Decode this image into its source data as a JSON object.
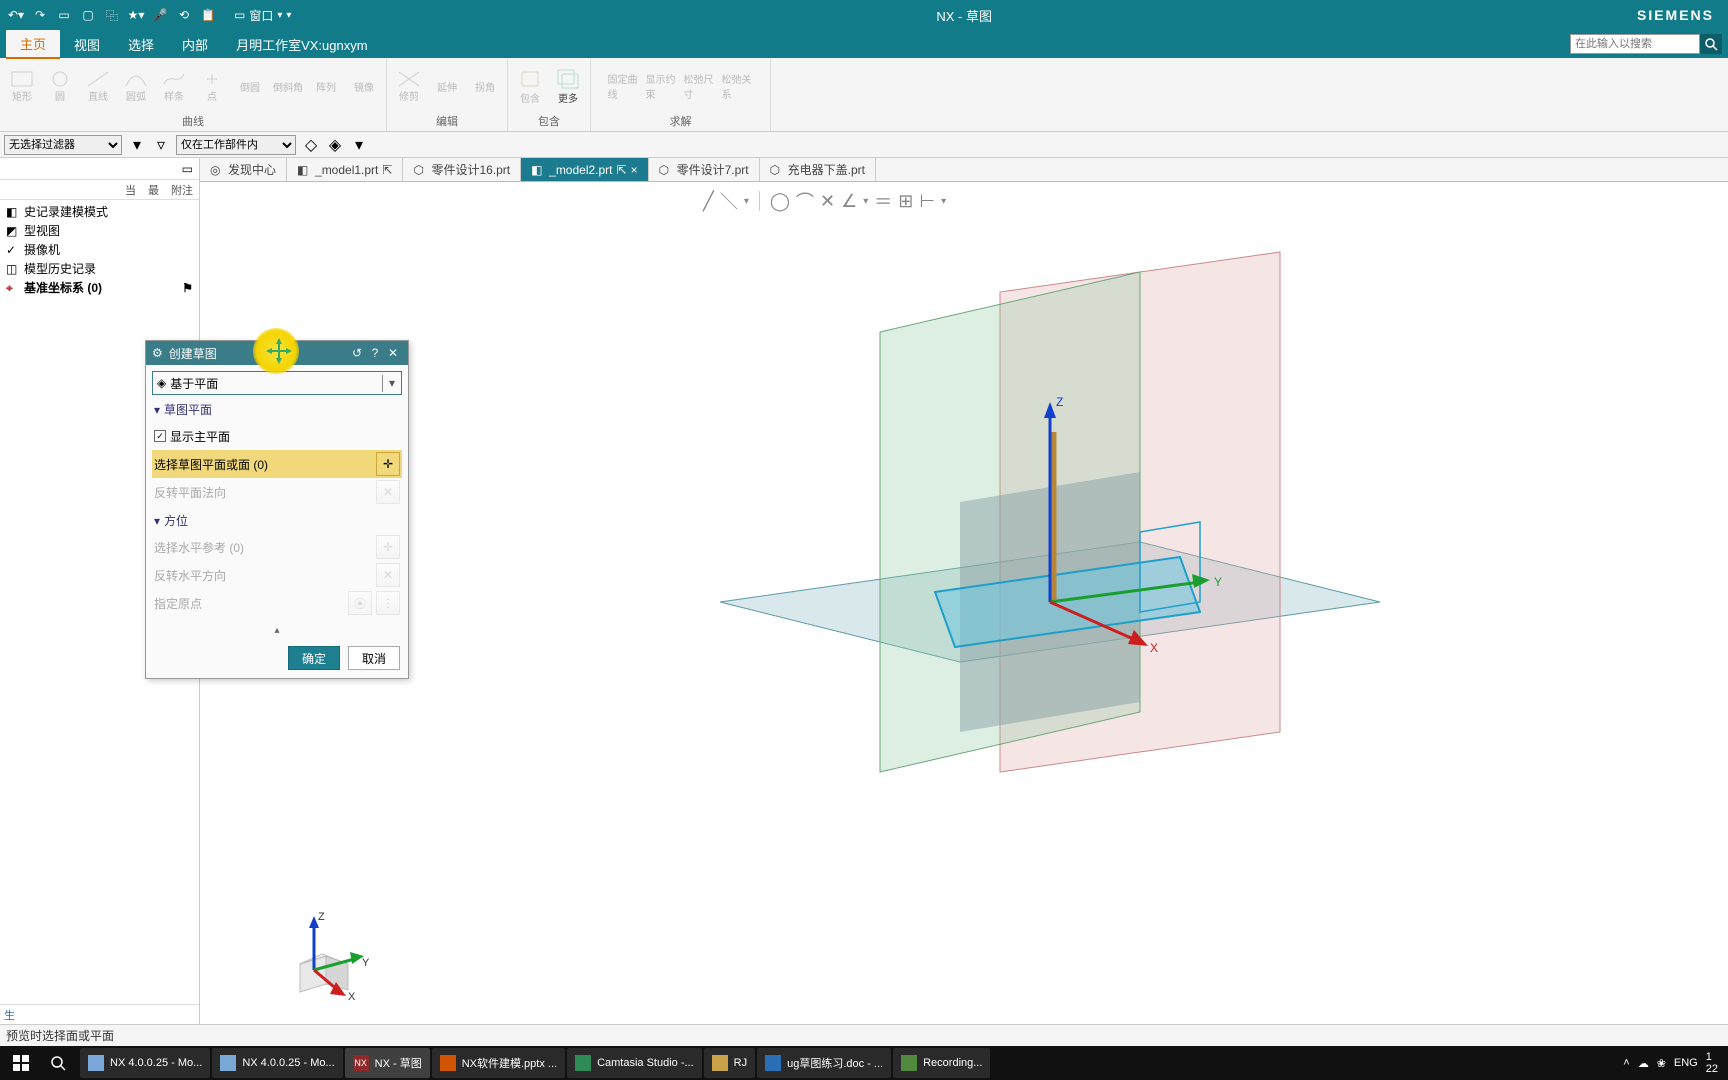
{
  "title_bar": {
    "app_title": "NX - 草图",
    "window_combo": "窗口",
    "brand": "SIEMENS"
  },
  "qat_icons": [
    "undo",
    "redo",
    "open",
    "save",
    "copy",
    "star",
    "mic",
    "record",
    "monitor"
  ],
  "ribbon_tabs": {
    "tabs": [
      "主页",
      "视图",
      "选择",
      "内部",
      "月明工作室VX:ugnxym"
    ],
    "active_index": 0,
    "search_placeholder": "在此输入以搜索"
  },
  "ribbon_groups": [
    {
      "label": "曲线",
      "items": [
        "矩形",
        "圆",
        "直线",
        "圆弧",
        "样条",
        "点",
        "倒圆",
        "倒斜角",
        "阵列",
        "镜像"
      ]
    },
    {
      "label": "编辑",
      "items": [
        "修剪",
        "延伸",
        "拐角"
      ]
    },
    {
      "label": "包含",
      "items": [
        "包含",
        "更多"
      ]
    },
    {
      "label": "求解",
      "items": [
        "固定曲线",
        "显示约束",
        "松弛尺寸",
        "松弛关系"
      ]
    }
  ],
  "selection_bar": {
    "filter1": "无选择过滤器",
    "filter2": "仅在工作部件内"
  },
  "nav_tree": {
    "hdr_tabs": [
      "当",
      "最",
      "附注"
    ],
    "rows": [
      {
        "label": "史记录建模模式",
        "icon": "history"
      },
      {
        "label": "型视图",
        "icon": "view"
      },
      {
        "label": "摄像机",
        "icon": "camera"
      },
      {
        "label": "模型历史记录",
        "icon": "history2"
      },
      {
        "label": "基准坐标系 (0)",
        "icon": "csys",
        "bold": true
      }
    ]
  },
  "doc_tabs": [
    {
      "label": "发现中心",
      "icon": "discover",
      "closable": false
    },
    {
      "label": "_model1.prt",
      "icon": "part",
      "closable": true
    },
    {
      "label": "零件设计16.prt",
      "icon": "part",
      "closable": false
    },
    {
      "label": "_model2.prt",
      "icon": "part",
      "closable": true,
      "active": true
    },
    {
      "label": "零件设计7.prt",
      "icon": "part",
      "closable": false
    },
    {
      "label": "充电器下盖.prt",
      "icon": "part",
      "closable": false
    }
  ],
  "dialog": {
    "title": "创建草图",
    "method": "基于平面",
    "section_plane": "草图平面",
    "show_main_plane": "显示主平面",
    "select_plane": "选择草图平面或面 (0)",
    "reverse_normal": "反转平面法向",
    "section_orient": "方位",
    "select_horiz": "选择水平参考 (0)",
    "reverse_horiz": "反转水平方向",
    "specify_origin": "指定原点",
    "ok": "确定",
    "cancel": "取消"
  },
  "axis_labels": {
    "x": "X",
    "y": "Y",
    "z": "Z"
  },
  "status_bar": {
    "prompt": "预览时选择面或平面"
  },
  "taskbar": {
    "items": [
      {
        "label": "NX 4.0.0.25 - Mo...",
        "color": "#7aa7d6"
      },
      {
        "label": "NX 4.0.0.25 - Mo...",
        "color": "#7aa7d6"
      },
      {
        "label": "NX - 草图",
        "color": "#8f2a2a",
        "active": true
      },
      {
        "label": "NX软件建模.pptx ...",
        "color": "#d35400"
      },
      {
        "label": "Camtasia Studio -...",
        "color": "#2e8b57"
      },
      {
        "label": "RJ",
        "color": "#caa24a"
      },
      {
        "label": "ug草图练习.doc - ...",
        "color": "#2a6fb5"
      },
      {
        "label": "Recording...",
        "color": "#518a3e"
      }
    ],
    "tray": {
      "lang": "ENG",
      "time": "1",
      "date": "22"
    }
  }
}
